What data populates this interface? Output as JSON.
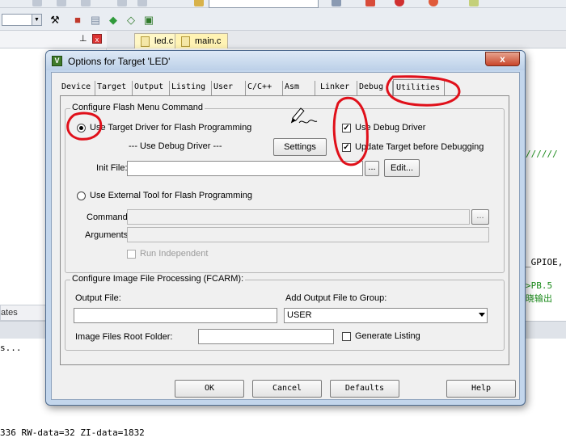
{
  "ide": {
    "file_tabs": [
      {
        "label": "led.c"
      },
      {
        "label": "main.c"
      }
    ],
    "panel_tab_label": "ates",
    "build_output": {
      "line1": "s...",
      "line2": "336 RW-data=32 ZI-data=1832"
    },
    "code_fragments": {
      "slashes": "//////",
      "gpio": "_GPIOE,",
      "pb5": ">PB.5 ",
      "cn": "晓输出"
    }
  },
  "dialog": {
    "title": "Options for Target 'LED'",
    "tabs": [
      {
        "label": "Device"
      },
      {
        "label": "Target"
      },
      {
        "label": "Output"
      },
      {
        "label": "Listing"
      },
      {
        "label": "User"
      },
      {
        "label": "C/C++"
      },
      {
        "label": "Asm"
      },
      {
        "label": "Linker"
      },
      {
        "label": "Debug"
      },
      {
        "label": "Utilities"
      }
    ],
    "active_tab": "Utilities",
    "flash": {
      "legend": "Configure Flash Menu Command",
      "use_target_driver_label": "Use Target Driver for Flash Programming",
      "use_target_driver_selected": true,
      "driver_value": "--- Use Debug Driver ---",
      "settings_label": "Settings",
      "use_debug_driver_label": "Use Debug Driver",
      "use_debug_driver_checked": true,
      "update_target_label": "Update Target before Debugging",
      "update_target_checked": true,
      "init_file_label": "Init File:",
      "init_file_value": "",
      "browse_label": "...",
      "edit_label": "Edit...",
      "use_external_tool_label": "Use External Tool for Flash Programming",
      "use_external_tool_selected": false,
      "command_label": "Command:",
      "command_value": "",
      "arguments_label": "Arguments:",
      "arguments_value": "",
      "run_independent_label": "Run Independent",
      "run_independent_checked": false
    },
    "image": {
      "legend": "Configure Image File Processing (FCARM):",
      "output_file_label": "Output File:",
      "output_file_value": "",
      "add_output_label": "Add Output File  to Group:",
      "group_value": "USER",
      "root_folder_label": "Image Files Root Folder:",
      "root_folder_value": "",
      "generate_listing_label": "Generate Listing",
      "generate_listing_checked": false
    },
    "buttons": {
      "ok": "OK",
      "cancel": "Cancel",
      "defaults": "Defaults",
      "help": "Help"
    },
    "close_glyph": "x",
    "icon_glyph": "V"
  },
  "annotation_color": "#e0101a"
}
